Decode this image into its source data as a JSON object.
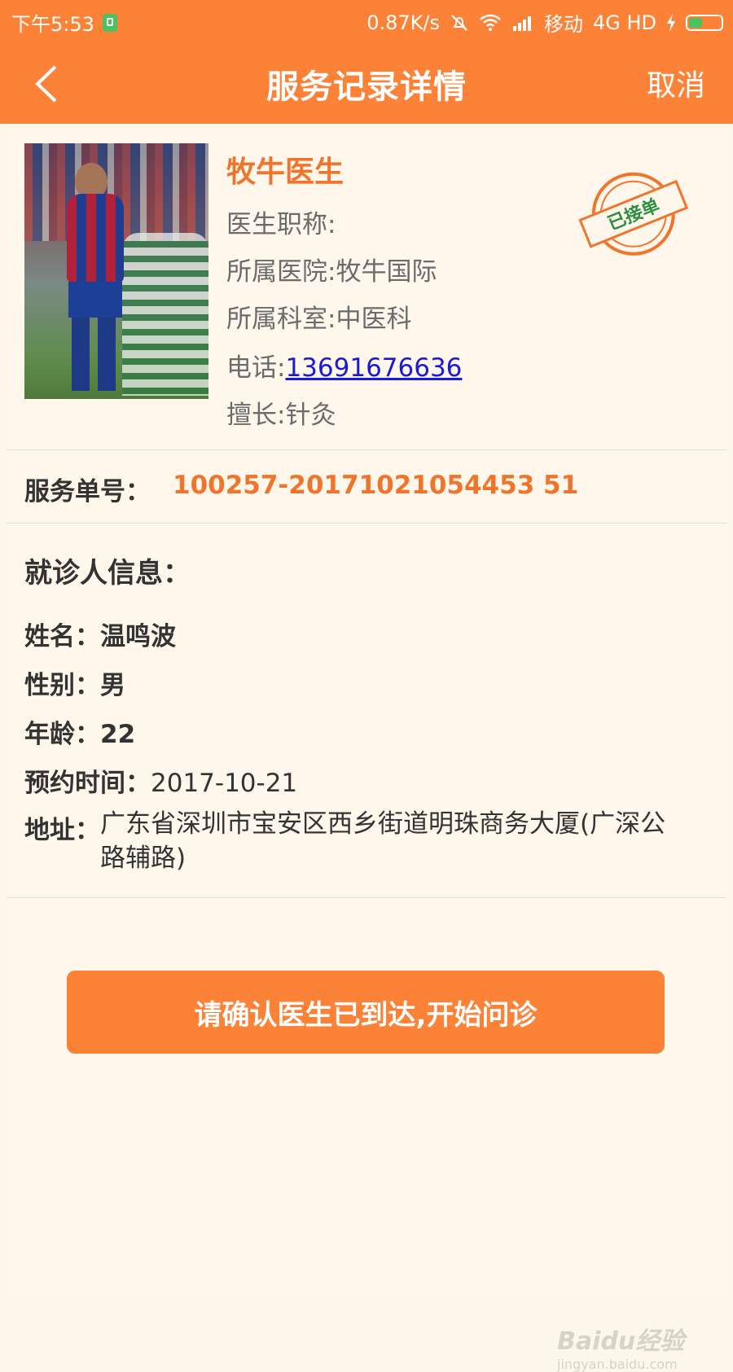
{
  "status_bar": {
    "time": "下午5:53",
    "speed": "0.87K/s",
    "carrier": "移动",
    "network": "4G HD"
  },
  "nav": {
    "title": "服务记录详情",
    "cancel_label": "取消"
  },
  "doctor": {
    "name": "牧牛医生",
    "title_line": "医生职称:",
    "hospital_line": "所属医院:牧牛国际",
    "department_line": "所属科室:中医科",
    "phone_label": "电话:",
    "phone_number": "13691676636",
    "specialty_line": "擅长:针灸",
    "status_stamp": "已接单"
  },
  "order": {
    "label": "服务单号：",
    "number": "100257-20171021054453 51"
  },
  "patient": {
    "heading": "就诊人信息：",
    "name_label": "姓名：",
    "name": "温鸣波",
    "gender_label": "性别：",
    "gender": "男",
    "age_label": "年龄：",
    "age": "22",
    "appointment_label": "预约时间：",
    "appointment_time": "2017-10-21",
    "address_label": "地址：",
    "address": "广东省深圳市宝安区西乡街道明珠商务大厦(广深公路辅路)"
  },
  "actions": {
    "confirm_label": "请确认医生已到达,开始问诊"
  },
  "watermark": {
    "brand": "Baidu经验",
    "url": "jingyan.baidu.com"
  },
  "colors": {
    "accent": "#fb8236",
    "accent_text": "#f0752c",
    "link": "#1b1bd6",
    "stamp_text": "#2c8f43",
    "background": "#fdf6ea"
  }
}
